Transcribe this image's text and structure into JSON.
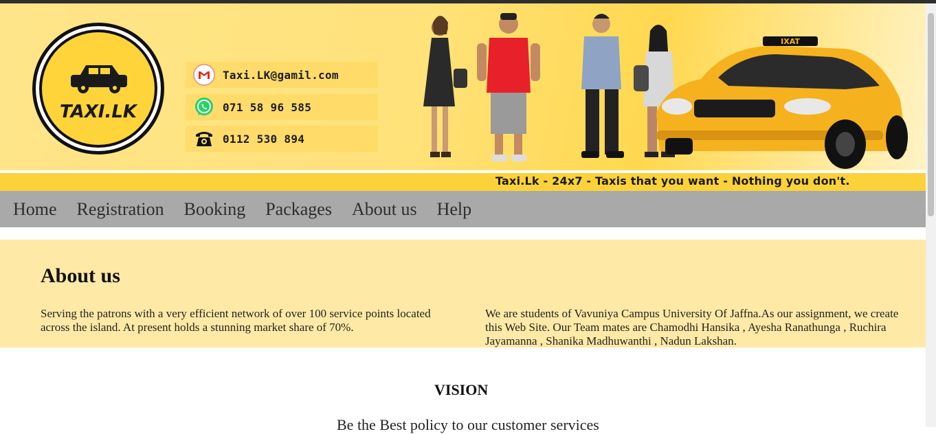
{
  "banner": {
    "logo_text": "TAXI.LK",
    "email": "Taxi.LK@gamil.com",
    "whatsapp": "071 58 96 585",
    "phone": "0112 530 894"
  },
  "tagline": "Taxi.Lk - 24x7 - Taxis that you want - Nothing you don't.",
  "nav": {
    "items": [
      "Home",
      "Registration",
      "Booking",
      "Packages",
      "About us",
      "Help"
    ]
  },
  "about": {
    "title": "About us",
    "left_text": "Serving the patrons with a very efficient network of over 100 service points located across the island. At present holds a stunning market share of 70%.",
    "right_text": "We are students of Vavuniya Campus University Of Jaffna.As our assignment, we create this Web Site. Our Team mates are Chamodhi Hansika , Ayesha Ranathunga , Ruchira Jayamanna , Shanika Madhuwanthi , Nadun Lakshan."
  },
  "vision": {
    "title": "VISION",
    "text": "Be the Best policy to our customer services"
  },
  "colors": {
    "banner_yellow": "#ffe27a",
    "tagline_yellow": "#fcd23a",
    "nav_gray": "#a9a9a9",
    "about_bg": "#ffe9a6",
    "taxi_yellow": "#f5b21e"
  },
  "icons": [
    "gmail-icon",
    "whatsapp-icon",
    "telephone-icon"
  ]
}
